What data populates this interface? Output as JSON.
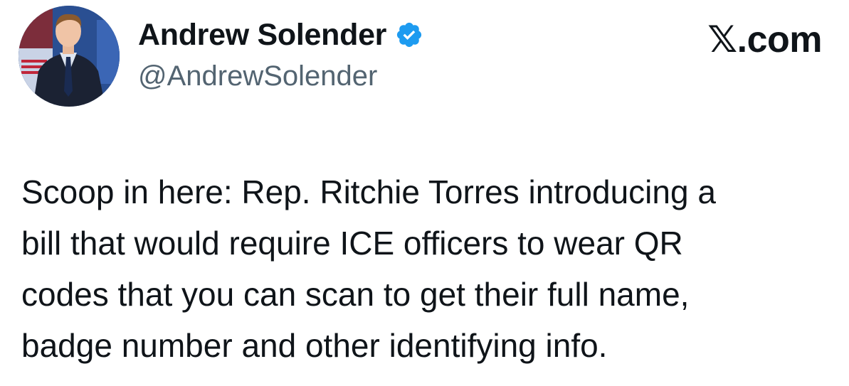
{
  "author": {
    "display_name": "Andrew Solender",
    "handle": "@AndrewSolender",
    "verified": true,
    "avatar_icon": "profile-photo"
  },
  "source": {
    "label": "𝕏.com"
  },
  "tweet": {
    "lines": [
      "Scoop in here: Rep. Ritchie Torres introducing a",
      "bill that would require ICE officers to wear QR",
      "codes that you can scan to get their full name,",
      "badge number and other identifying info."
    ]
  },
  "colors": {
    "text_primary": "#0f1419",
    "text_secondary": "#536471",
    "verified_blue": "#1d9bf0",
    "background": "#ffffff"
  }
}
